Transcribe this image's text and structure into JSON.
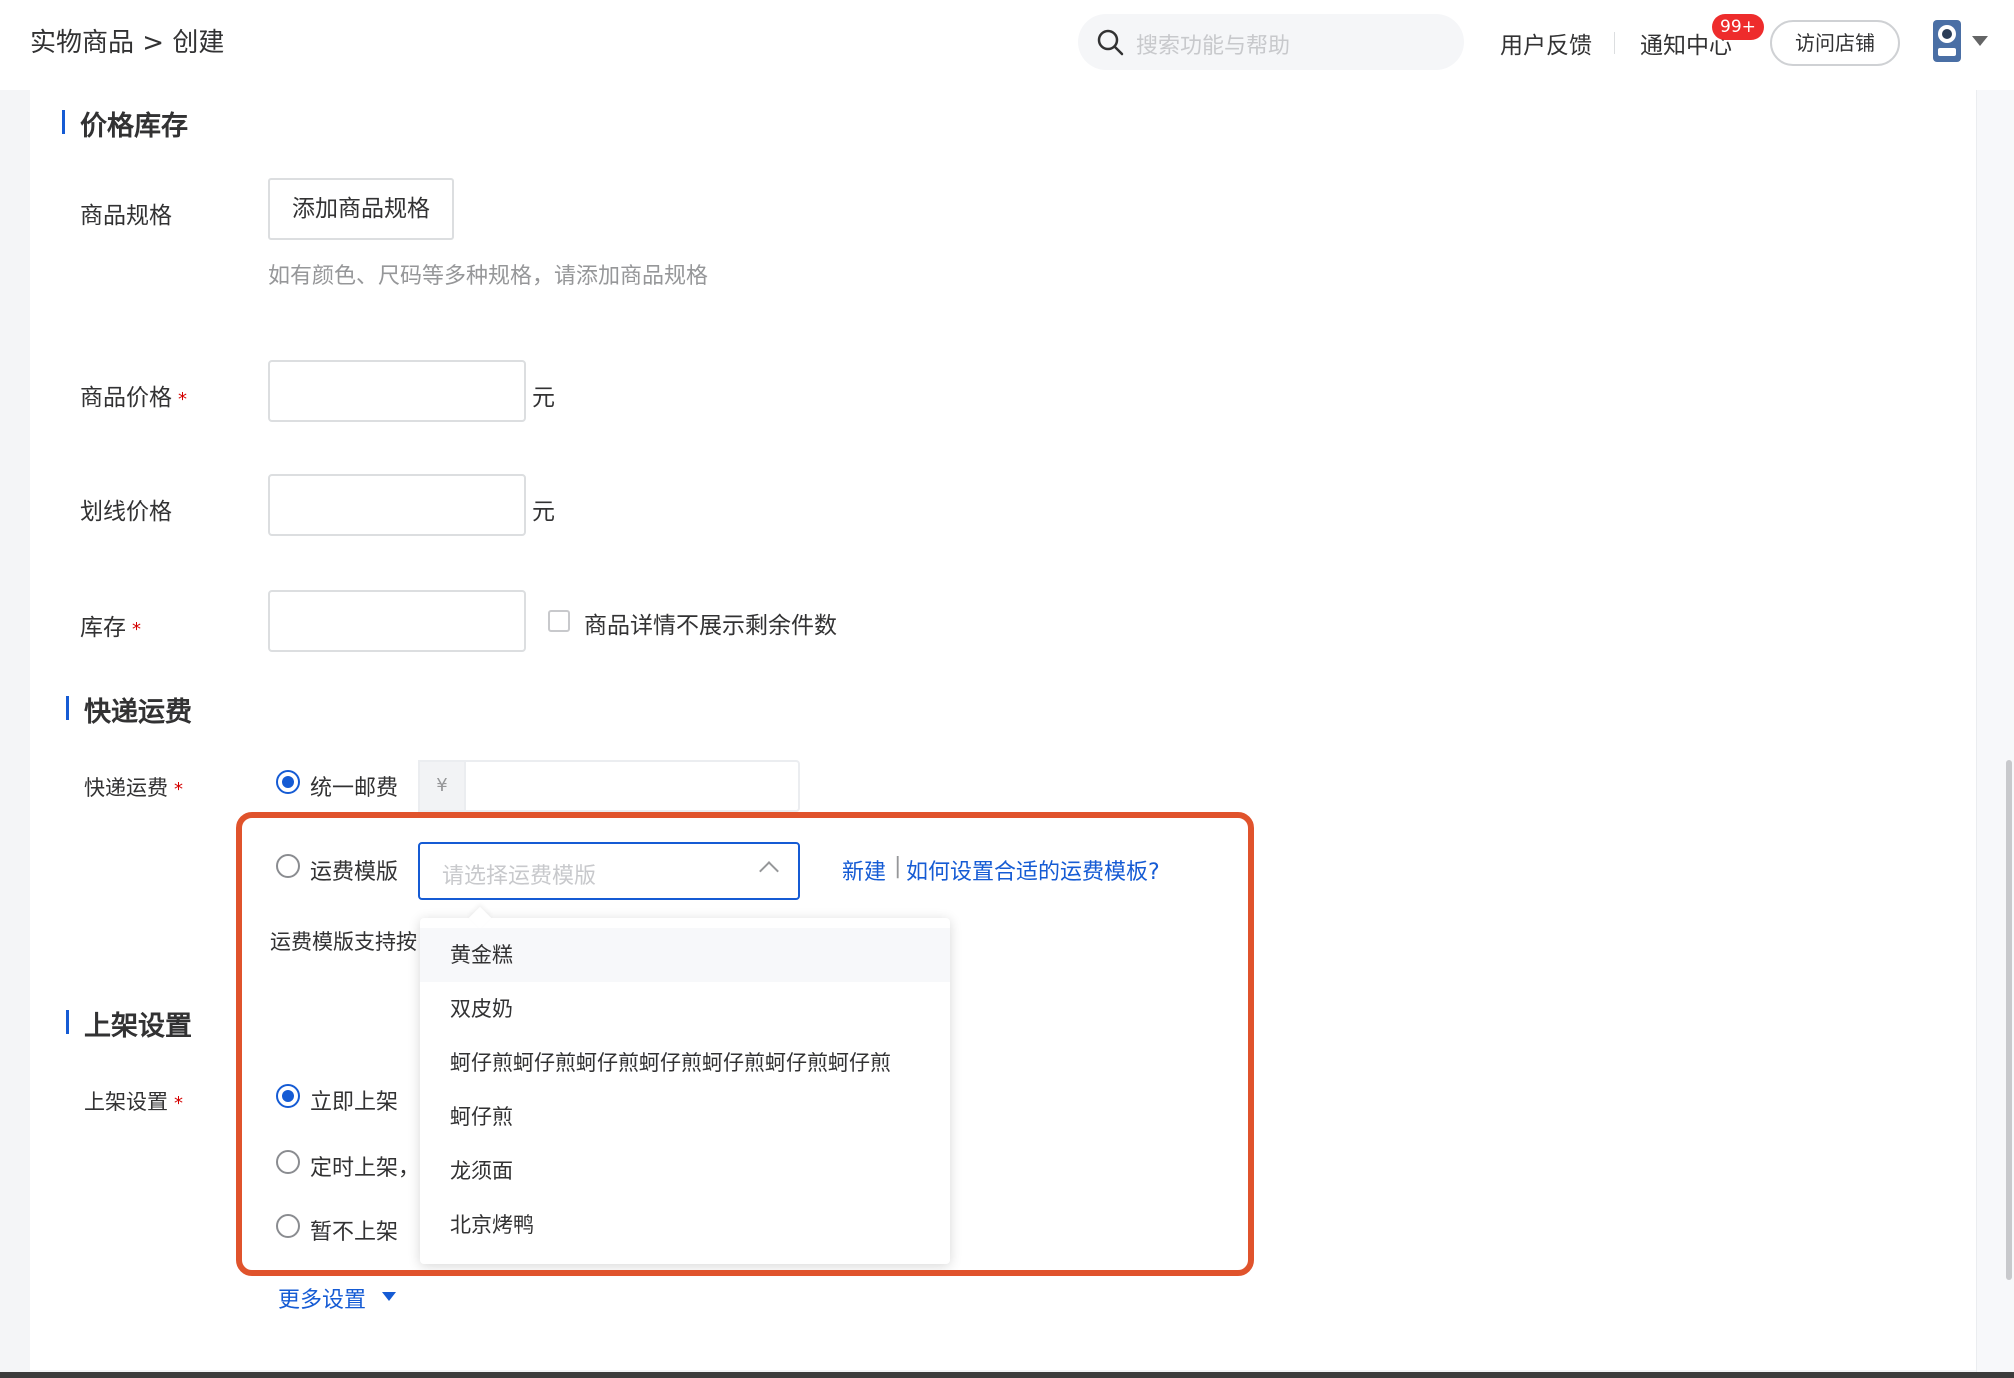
{
  "header": {
    "breadcrumb": "实物商品 > 创建",
    "search_placeholder": "搜索功能与帮助",
    "feedback": "用户反馈",
    "notifications": "通知中心",
    "notification_badge": "99+",
    "visit_store": "访问店铺"
  },
  "price_stock": {
    "title": "价格库存",
    "spec_label": "商品规格",
    "add_spec_button": "添加商品规格",
    "spec_help": "如有颜色、尺码等多种规格，请添加商品规格",
    "price_label": "商品价格",
    "price_value": "",
    "price_unit": "元",
    "strike_price_label": "划线价格",
    "strike_price_value": "",
    "strike_price_unit": "元",
    "stock_label": "库存",
    "stock_value": "",
    "hide_stock_checkbox": "商品详情不展示剩余件数",
    "required_mark": "*"
  },
  "shipping": {
    "title": "快递运费",
    "label": "快递运费",
    "option_flat": "统一邮费",
    "flat_prefix": "¥",
    "flat_value": "",
    "option_template": "运费模版",
    "template_placeholder": "请选择运费模版",
    "link_new": "新建",
    "link_sep": "|",
    "link_howto": "如何设置合适的运费模板?",
    "template_help": "运费模版支持按",
    "selected": "flat",
    "dropdown_options": [
      "黄金糕",
      "双皮奶",
      "蚵仔煎蚵仔煎蚵仔煎蚵仔煎蚵仔煎蚵仔煎蚵仔煎",
      "蚵仔煎",
      "龙须面",
      "北京烤鸭"
    ],
    "hovered_option_index": 0
  },
  "listing": {
    "title": "上架设置",
    "label": "上架设置",
    "option_now": "立即上架",
    "option_timed": "定时上架，",
    "option_later": "暂不上架",
    "selected": "now"
  },
  "more_settings": "更多设置",
  "colors": {
    "accent": "#155bd4",
    "highlight_border": "#e0532c",
    "required": "#d40000",
    "badge": "#ee2c2c"
  }
}
